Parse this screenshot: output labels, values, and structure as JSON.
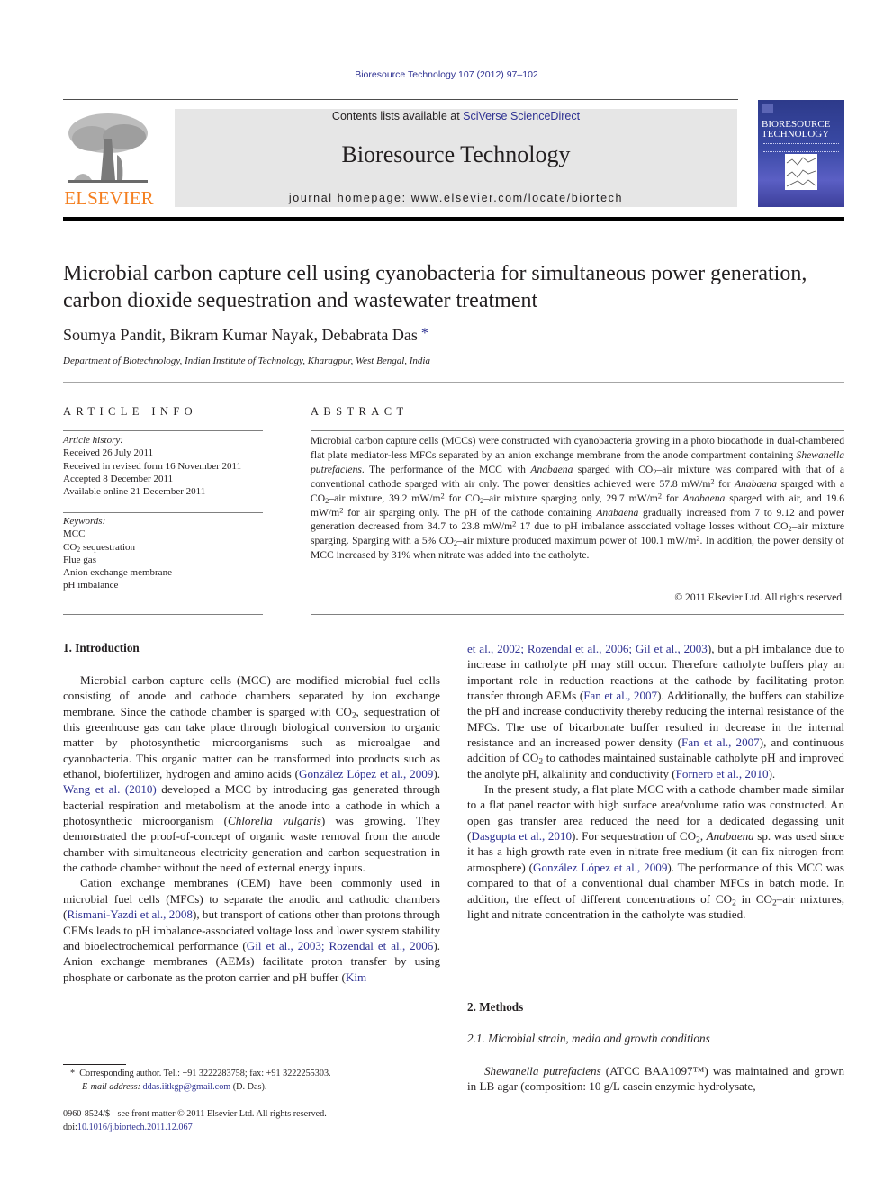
{
  "header": {
    "citation": "Bioresource Technology 107 (2012) 97–102",
    "contents_prefix": "Contents lists available at ",
    "contents_link": "SciVerse ScienceDirect",
    "journal_title": "Bioresource Technology",
    "homepage": "journal homepage: www.elsevier.com/locate/biortech",
    "publisher_logo_text": "ELSEVIER",
    "cover_title_line1": "BIORESOURCE",
    "cover_title_line2": "TECHNOLOGY",
    "colors": {
      "link": "#2e3192",
      "elsevier_orange": "#f47f20",
      "banner_bg": "#e6e6e6"
    }
  },
  "article": {
    "title": "Microbial carbon capture cell using cyanobacteria for simultaneous power generation, carbon dioxide sequestration and wastewater treatment",
    "authors": "Soumya Pandit, Bikram Kumar Nayak, Debabrata Das",
    "corresponding_mark": "*",
    "affiliation": "Department of Biotechnology, Indian Institute of Technology, Kharagpur, West Bengal, India"
  },
  "article_info": {
    "heading": "ARTICLE INFO",
    "history_label": "Article history:",
    "history": [
      "Received 26 July 2011",
      "Received in revised form 16 November 2011",
      "Accepted 8 December 2011",
      "Available online 21 December 2011"
    ],
    "keywords_label": "Keywords:",
    "keywords": [
      "MCC",
      "CO2 sequestration",
      "Flue gas",
      "Anion exchange membrane",
      "pH imbalance"
    ]
  },
  "abstract": {
    "heading": "ABSTRACT",
    "copyright": "© 2011 Elsevier Ltd. All rights reserved."
  },
  "sections": {
    "intro_heading": "1. Introduction",
    "methods_heading": "2. Methods",
    "methods_sub": "2.1. Microbial strain, media and growth conditions"
  },
  "citations": {
    "gonzalez": "González López et al., 2009",
    "wang": "Wang et al. (2010)",
    "rismani": "Rismani-Yazdi et al., 2008",
    "gil_rozendal": "Gil et al., 2003; Rozendal et al., 2006",
    "kim": "Kim",
    "kim_cont": "et al., 2002; Rozendal et al., 2006; Gil et al., 2003",
    "fan1": "Fan et al., 2007",
    "fan2": "Fan et al., 2007",
    "fornero": "Fornero et al., 2010",
    "dasgupta": "Dasgupta et al., 2010",
    "gonzalez2": "González López et al., 2009"
  },
  "footnote": {
    "mark": "*",
    "corresponding": "Corresponding author. Tel.: +91 3222283758; fax: +91 3222255303.",
    "email_label": "E-mail address:",
    "email": "ddas.iitkgp@gmail.com",
    "email_suffix": "(D. Das).",
    "issn": "0960-8524/$ - see front matter © 2011 Elsevier Ltd. All rights reserved.",
    "doi_label": "doi:",
    "doi": "10.1016/j.biortech.2011.12.067"
  }
}
